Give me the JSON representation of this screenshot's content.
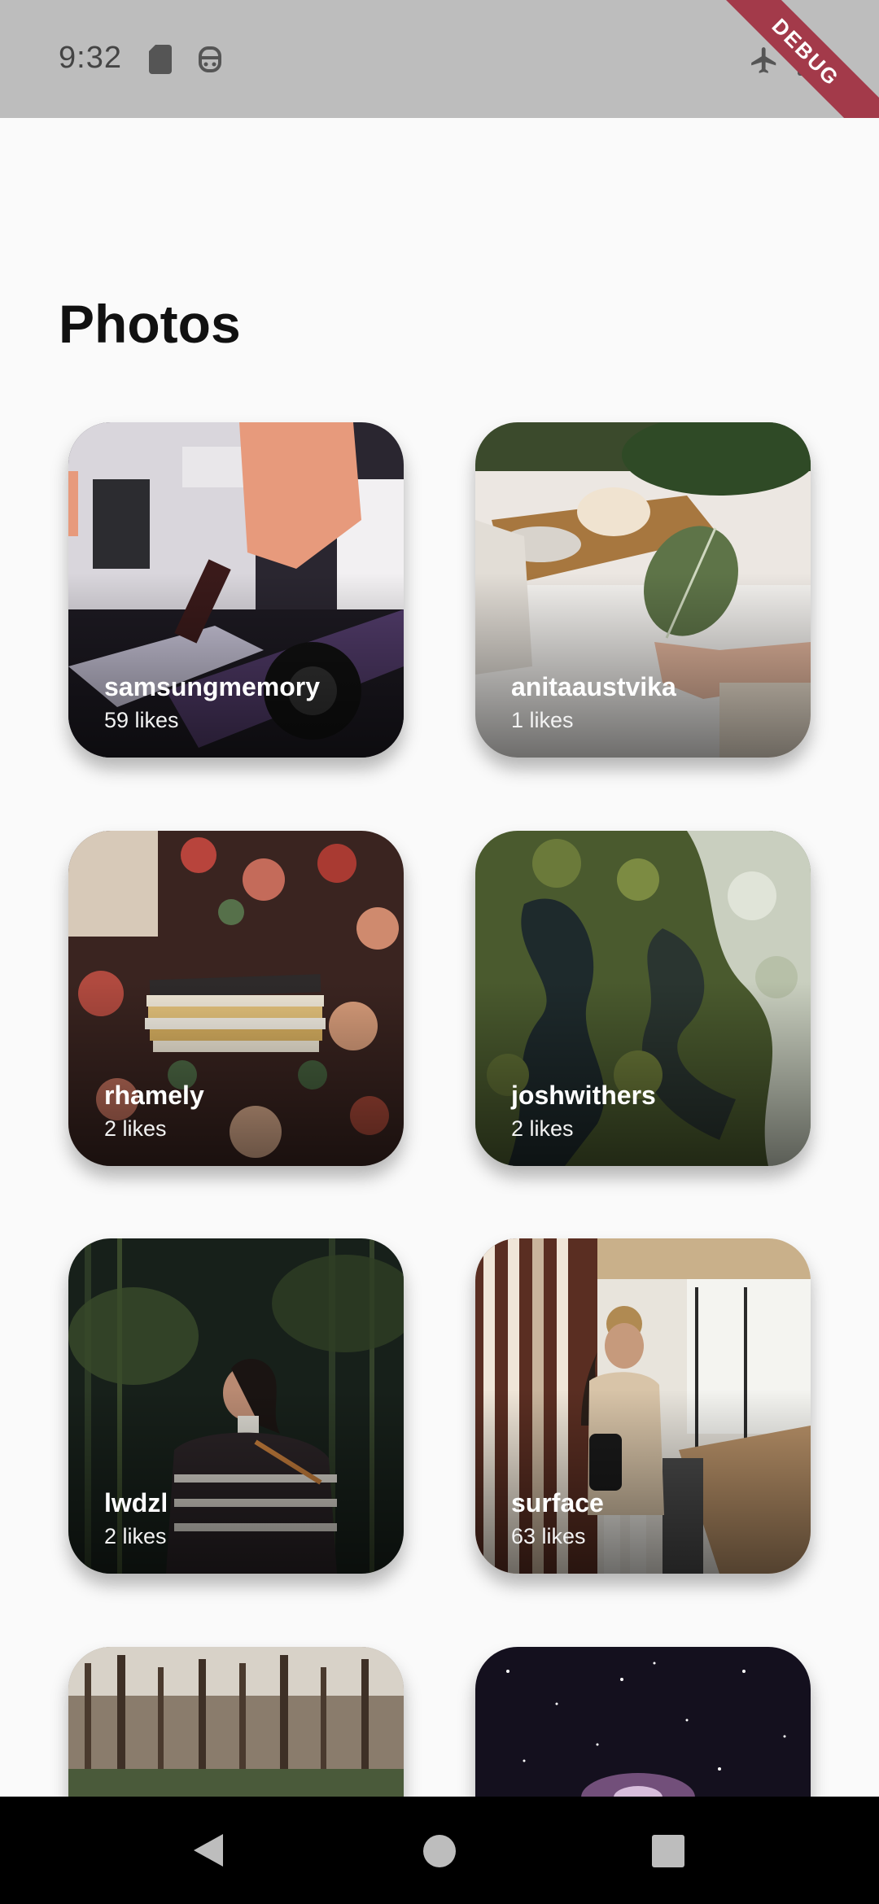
{
  "status_bar": {
    "time": "9:32",
    "icons": [
      "sd-card-icon",
      "android-robot-icon",
      "airplane-mode-icon",
      "battery-icon"
    ],
    "debug_banner": "DEBUG"
  },
  "page": {
    "title": "Photos"
  },
  "photos": [
    {
      "user": "samsungmemory",
      "likes": "59 likes"
    },
    {
      "user": "anitaaustvika",
      "likes": "1 likes"
    },
    {
      "user": "rhamely",
      "likes": "2 likes"
    },
    {
      "user": "joshwithers",
      "likes": "2 likes"
    },
    {
      "user": "lwdzl",
      "likes": "2 likes"
    },
    {
      "user": "surface",
      "likes": "63 likes"
    },
    {
      "user": "",
      "likes": ""
    },
    {
      "user": "",
      "likes": ""
    }
  ],
  "nav_bar": {
    "icons": [
      "back-icon",
      "home-icon",
      "recents-icon"
    ]
  }
}
